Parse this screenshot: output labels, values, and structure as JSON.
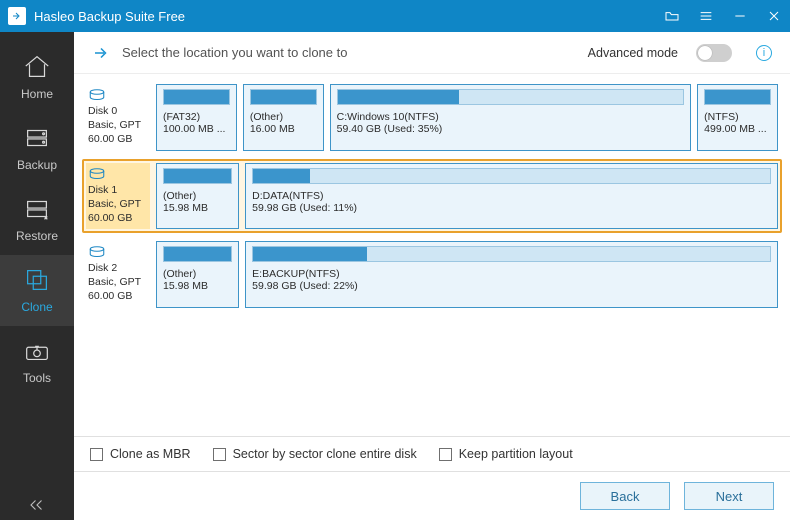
{
  "app_title": "Hasleo Backup Suite Free",
  "sidebar": {
    "items": [
      {
        "label": "Home"
      },
      {
        "label": "Backup"
      },
      {
        "label": "Restore"
      },
      {
        "label": "Clone"
      },
      {
        "label": "Tools"
      }
    ],
    "active_index": 3
  },
  "instruction": {
    "text": "Select the location you want to clone to",
    "advanced_label": "Advanced mode",
    "advanced_on": false
  },
  "disks": [
    {
      "name": "Disk 0",
      "type": "Basic, GPT",
      "size": "60.00 GB",
      "selected": false,
      "partitions": [
        {
          "line1": "(FAT32)",
          "line2": "100.00 MB ...",
          "fill_pct": 100,
          "flex": 1
        },
        {
          "line1": "(Other)",
          "line2": "16.00 MB",
          "fill_pct": 100,
          "flex": 1
        },
        {
          "line1": "C:Windows 10(NTFS)",
          "line2": "59.40 GB (Used: 35%)",
          "fill_pct": 35,
          "flex": 5.2
        },
        {
          "line1": "(NTFS)",
          "line2": "499.00 MB ...",
          "fill_pct": 100,
          "flex": 1
        }
      ]
    },
    {
      "name": "Disk 1",
      "type": "Basic, GPT",
      "size": "60.00 GB",
      "selected": true,
      "partitions": [
        {
          "line1": "(Other)",
          "line2": "15.98 MB",
          "fill_pct": 100,
          "flex": 1
        },
        {
          "line1": "D:DATA(NTFS)",
          "line2": "59.98 GB (Used: 11%)",
          "fill_pct": 11,
          "flex": 7.5
        }
      ]
    },
    {
      "name": "Disk 2",
      "type": "Basic, GPT",
      "size": "60.00 GB",
      "selected": false,
      "partitions": [
        {
          "line1": "(Other)",
          "line2": "15.98 MB",
          "fill_pct": 100,
          "flex": 1
        },
        {
          "line1": "E:BACKUP(NTFS)",
          "line2": "59.98 GB (Used: 22%)",
          "fill_pct": 22,
          "flex": 7.5
        }
      ]
    }
  ],
  "options": [
    {
      "label": "Clone as MBR",
      "checked": false
    },
    {
      "label": "Sector by sector clone entire disk",
      "checked": false
    },
    {
      "label": "Keep partition layout",
      "checked": false
    }
  ],
  "footer": {
    "back": "Back",
    "next": "Next"
  }
}
